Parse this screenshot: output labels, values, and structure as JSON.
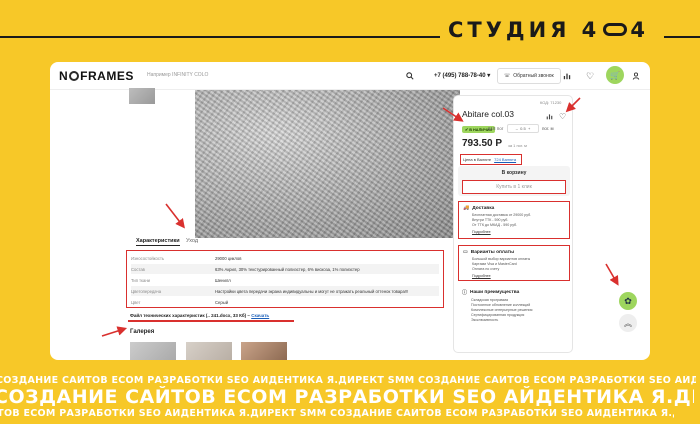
{
  "studio": {
    "title_prefix": "СТУДИЯ 4",
    "title_suffix": "4"
  },
  "header": {
    "logo_left": "N",
    "logo_right": "FRAMES",
    "search_placeholder": "Например INFINITY COLO",
    "phone": "+7 (495) 788-78-40",
    "callback_label": "Обратный звонок"
  },
  "tabs": {
    "active": "Характеристики",
    "second": "Уход"
  },
  "specs": [
    {
      "k": "Износостойкость",
      "v": "29000 циклов"
    },
    {
      "k": "Состав",
      "v": "63% Акрил, 30% текстурированный полиэстер, 6% вискоза, 1% полиэстер"
    },
    {
      "k": "Тип ткани",
      "v": "Шенилл"
    },
    {
      "k": "Цветопередача",
      "v": "Настройки цвета передачи экрана индивидуальны и могут не отражать реальный оттенок товара!!!"
    },
    {
      "k": "Цвет",
      "v": "Серый"
    }
  ],
  "download": {
    "text": "Файл технических характеристик (.. 241.docx, 33 Кб) –",
    "link": "Скачать"
  },
  "gallery_title": "Галерея",
  "product": {
    "article": "КОД: 71230",
    "title": "Abitare col.03",
    "stock": "В НАЛИЧИИ",
    "code": "918 пог",
    "qty": "0.5",
    "unit": "пог. м",
    "price": "793.50 Р",
    "price_sub": "за 1 пог. м",
    "price_note": "Цена в Валюте",
    "price_link": "724 Валюта",
    "cart_label": "В корзину",
    "buy_one_label": "Купить в 1 клик"
  },
  "delivery": {
    "title": "Доставка",
    "lines": [
      "Бесплатная доставка от 29000 руб.",
      "Внутри ТТК - 590 руб.",
      "От ТТК до МКАД - 590 руб."
    ],
    "more": "Подробнее"
  },
  "payment": {
    "title": "Варианты оплаты",
    "lines": [
      "Большой выбор вариантов оплаты",
      "Картами Visa и MasterCard",
      "Оплата по счету"
    ],
    "more": "Подробнее"
  },
  "advantages": {
    "title": "Наши преимущества",
    "lines": [
      "Складская программа",
      "Постоянное обновление коллекций",
      "Комплексные интерьерные решения",
      "Сертифицированная продукция",
      "Эксклюзивность"
    ]
  },
  "marquee": {
    "small_row": "СОЗДАНИЕ САЙТОВ   ECOM РАЗРАБОТКИ   SEO   АЙДЕНТИКА   Я.ДИРЕКТ   SMM   СОЗДАНИЕ САЙТОВ   ECOM РАЗРАБОТКИ   SEO   АЙДЕНТИКА   Я.ДИРЕКТ   SMM",
    "big_row": "СОЗДАНИЕ САЙТОВ   ECOM РАЗРАБОТКИ   SEO   АЙДЕНТИКА   Я.ДИРЕКТ   SMM",
    "small_row2": "САЙТОВ   ECOM РАЗРАБОТКИ   SEO   АЙДЕНТИКА   Я.ДИРЕКТ   SMM   СОЗДАНИЕ САЙТОВ   ECOM РАЗРАБОТКИ   SEO   АЙДЕНТИКА   Я.ДИРЕКТ   SMM"
  },
  "colors": {
    "background": "#f7c828",
    "accent_green": "#9ed65e",
    "annotation_red": "#d9302e"
  }
}
